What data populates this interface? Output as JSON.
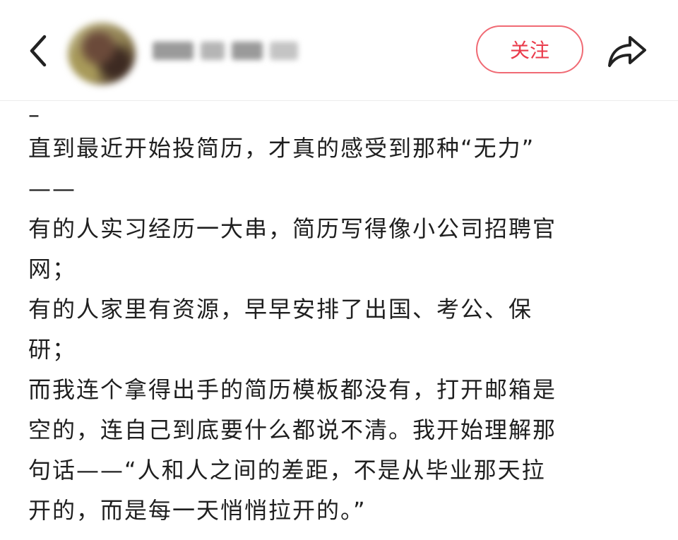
{
  "header": {
    "follow_label": "关注"
  },
  "post": {
    "lines": [
      "–",
      "直到最近开始投简历，才真的感受到那种“无力”",
      "——",
      "有的人实习经历一大串，简历写得像小公司招聘官",
      "网；",
      "有的人家里有资源，早早安排了出国、考公、保",
      "研；",
      "而我连个拿得出手的简历模板都没有，打开邮箱是",
      "空的，连自己到底要什么都说不清。我开始理解那",
      "句话——“人和人之间的差距，不是从毕业那天拉",
      "开的，而是每一天悄悄拉开的。”"
    ]
  }
}
